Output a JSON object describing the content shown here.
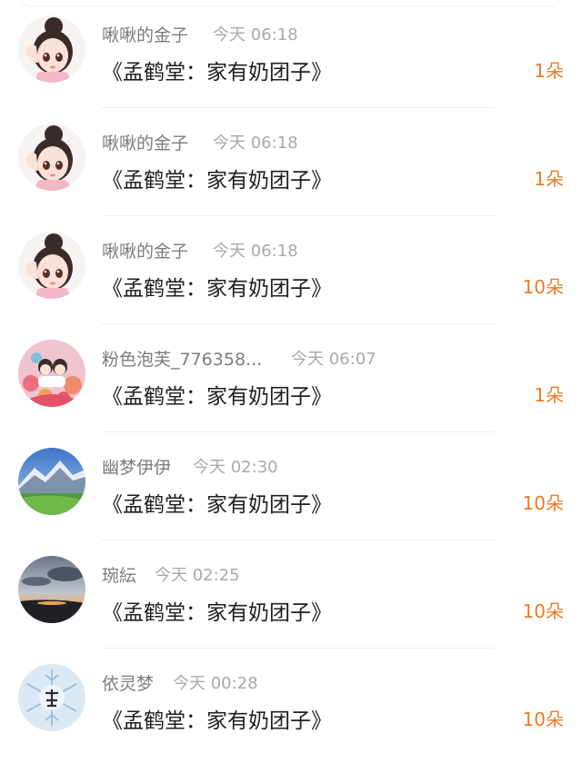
{
  "entries": [
    {
      "name": "啾啾的金子",
      "time": "今天 06:18",
      "title": "《孟鹤堂：家有奶团子》",
      "amount": "1朵",
      "avatar": "girl-avatar"
    },
    {
      "name": "啾啾的金子",
      "time": "今天 06:18",
      "title": "《孟鹤堂：家有奶团子》",
      "amount": "1朵",
      "avatar": "girl-avatar"
    },
    {
      "name": "啾啾的金子",
      "time": "今天 06:18",
      "title": "《孟鹤堂：家有奶团子》",
      "amount": "10朵",
      "avatar": "girl-avatar"
    },
    {
      "name": "粉色泡芙_776358...",
      "time": "今天 06:07",
      "title": "《孟鹤堂：家有奶团子》",
      "amount": "1朵",
      "avatar": "flowers-avatar"
    },
    {
      "name": "幽梦伊伊",
      "time": "今天 02:30",
      "title": "《孟鹤堂：家有奶团子》",
      "amount": "10朵",
      "avatar": "mountain-avatar"
    },
    {
      "name": "琬紜",
      "time": "今天 02:25",
      "title": "《孟鹤堂：家有奶团子》",
      "amount": "10朵",
      "avatar": "sunset-avatar"
    },
    {
      "name": "依灵梦",
      "time": "今天 00:28",
      "title": "《孟鹤堂：家有奶团子》",
      "amount": "10朵",
      "avatar": "snowflake-avatar"
    }
  ],
  "colors": {
    "accent": "#f07a23",
    "name": "#7d7d7d",
    "time": "#a9a9a9",
    "title": "#1f1f1f",
    "divider": "#efefef"
  }
}
